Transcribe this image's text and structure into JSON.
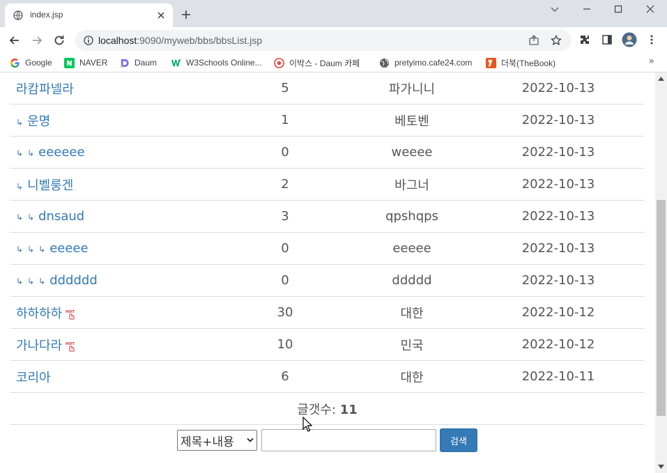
{
  "browser": {
    "tab_title": "index.jsp",
    "url_host": "localhost",
    "url_rest": ":9090/myweb/bbs/bbsList.jsp",
    "bookmarks": [
      {
        "label": "Google",
        "icon": "google-icon"
      },
      {
        "label": "NAVER",
        "icon": "naver-icon"
      },
      {
        "label": "Daum",
        "icon": "daum-icon"
      },
      {
        "label": "W3Schools Online...",
        "icon": "w3schools-icon"
      },
      {
        "label": "이박스 - Daum 카페",
        "icon": "daum-cafe-icon"
      },
      {
        "label": "pretyimo.cafe24.com",
        "icon": "globe-icon"
      },
      {
        "label": "더북(TheBook)",
        "icon": "thebook-icon"
      }
    ]
  },
  "board": {
    "rows": [
      {
        "indent": 0,
        "title": "라캄파넬라",
        "count": "5",
        "name": "파가니니",
        "date": "2022-10-13",
        "hot": false
      },
      {
        "indent": 1,
        "title": "운명",
        "count": "1",
        "name": "베토벤",
        "date": "2022-10-13",
        "hot": false
      },
      {
        "indent": 2,
        "title": "eeeeee",
        "count": "0",
        "name": "weeee",
        "date": "2022-10-13",
        "hot": false
      },
      {
        "indent": 1,
        "title": "니벨룽겐",
        "count": "2",
        "name": "바그너",
        "date": "2022-10-13",
        "hot": false
      },
      {
        "indent": 2,
        "title": "dnsaud",
        "count": "3",
        "name": "qpshqps",
        "date": "2022-10-13",
        "hot": false
      },
      {
        "indent": 3,
        "title": "eeeee",
        "count": "0",
        "name": "eeeee",
        "date": "2022-10-13",
        "hot": false
      },
      {
        "indent": 3,
        "title": "dddddd",
        "count": "0",
        "name": "ddddd",
        "date": "2022-10-13",
        "hot": false
      },
      {
        "indent": 0,
        "title": "하하하하",
        "count": "30",
        "name": "대한",
        "date": "2022-10-12",
        "hot": true
      },
      {
        "indent": 0,
        "title": "가나다라",
        "count": "10",
        "name": "민국",
        "date": "2022-10-12",
        "hot": true
      },
      {
        "indent": 0,
        "title": "코리아",
        "count": "6",
        "name": "대한",
        "date": "2022-10-11",
        "hot": false
      }
    ],
    "reply_arrow": "↳",
    "total_label": "글갯수: ",
    "total_value": "11",
    "hot_badge": "HOT"
  },
  "search": {
    "selected_option": "제목+내용",
    "keyword_value": "",
    "button_label": "검색"
  },
  "colors": {
    "link": "#337ab7",
    "button": "#337ab7",
    "text": "#555555"
  }
}
